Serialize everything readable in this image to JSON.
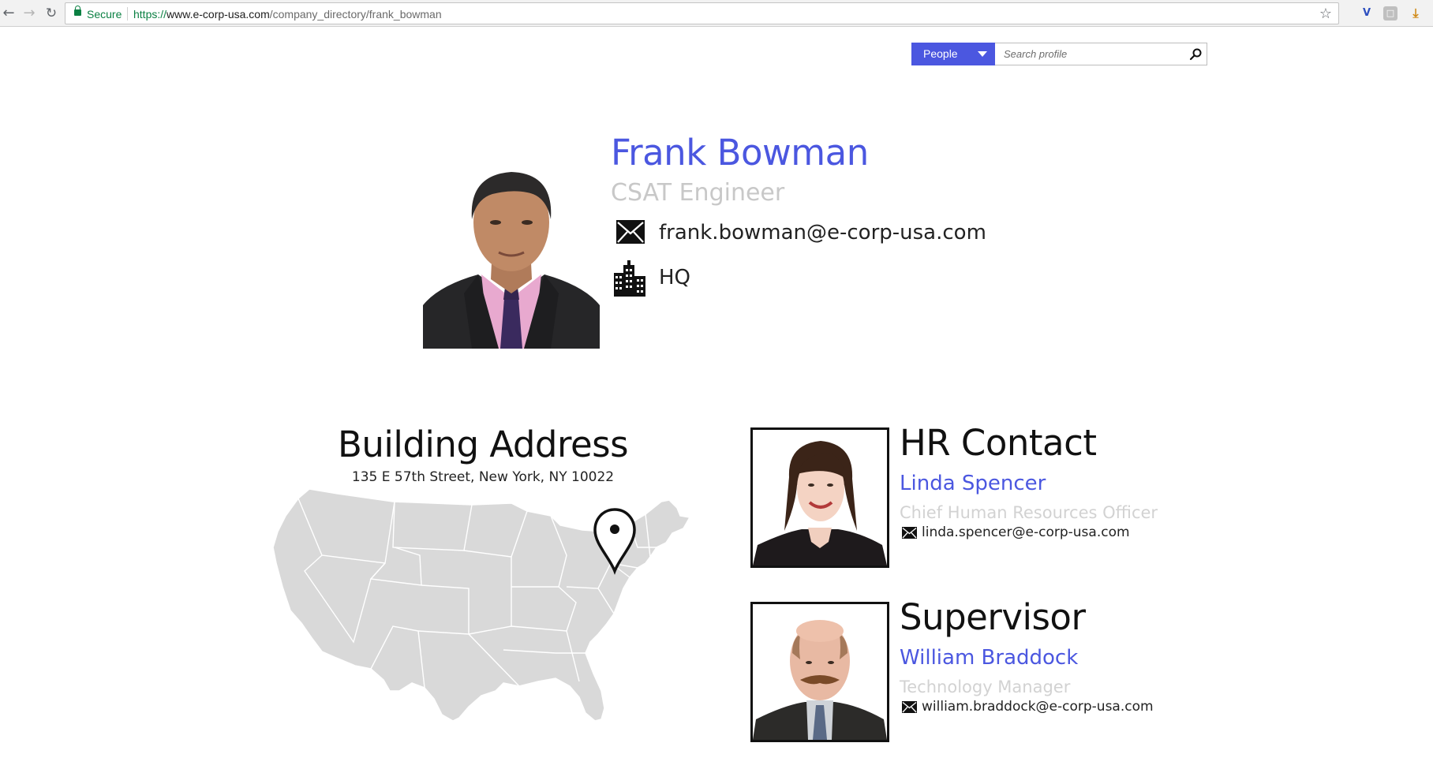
{
  "browser": {
    "secure_label": "Secure",
    "url_scheme": "https://",
    "url_host": "www.e-corp-usa.com",
    "url_path": "/company_directory/frank_bowman"
  },
  "search": {
    "scope_label": "People",
    "placeholder": "Search profile"
  },
  "profile": {
    "name": "Frank Bowman",
    "title": "CSAT Engineer",
    "email": "frank.bowman@e-corp-usa.com",
    "office": "HQ"
  },
  "building": {
    "heading": "Building Address",
    "address": "135 E 57th Street, New York, NY 10022"
  },
  "hr_contact": {
    "heading": "HR Contact",
    "name": "Linda Spencer",
    "title": "Chief Human Resources Officer",
    "email": "linda.spencer@e-corp-usa.com"
  },
  "supervisor": {
    "heading": "Supervisor",
    "name": "William Braddock",
    "title": "Technology Manager",
    "email": "william.braddock@e-corp-usa.com"
  },
  "colors": {
    "accent": "#4b57e0",
    "muted_text": "#c8c8c8",
    "map_fill": "#d9d9d9",
    "secure_green": "#0b8043"
  },
  "icons": [
    "back-icon",
    "forward-icon",
    "reload-icon",
    "lock-icon",
    "bookmark-star-icon",
    "dropdown-caret-icon",
    "search-icon",
    "envelope-icon",
    "building-icon",
    "map-pin-icon"
  ]
}
